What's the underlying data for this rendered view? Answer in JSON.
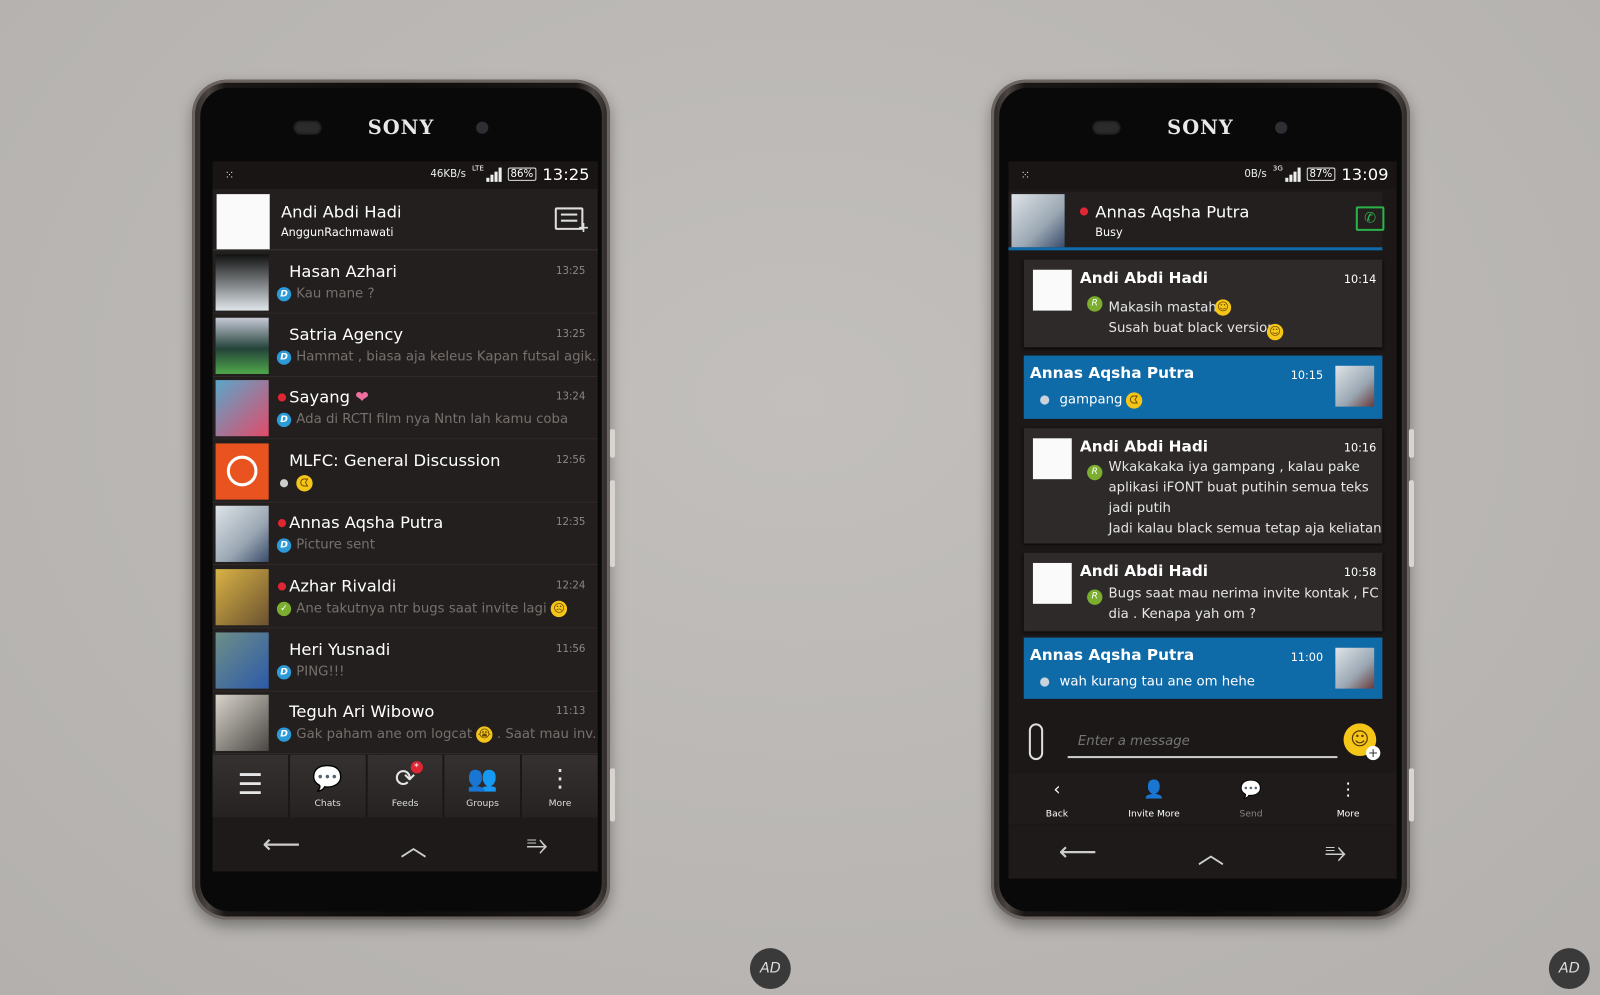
{
  "brand": "SONY",
  "colors": {
    "accent_blue": "#0f6aa8",
    "busy_red": "#e02633",
    "bbm_badge": "#2d9ad8",
    "read_green": "#7bad2e",
    "call_green": "#2bb34a"
  },
  "left": {
    "status": {
      "speed": "46KB/s",
      "network": "LTE",
      "battery": "86%",
      "time": "13:25"
    },
    "profile": {
      "name": "Andi Abdi Hadi",
      "status": "AnggunRachmawati",
      "new_chat_icon": "new-chat-icon"
    },
    "chats": [
      {
        "name": "Hasan Azhari",
        "time": "13:25",
        "message": "Kau mane ?",
        "badge": "D",
        "busy": false
      },
      {
        "name": "Satria Agency",
        "time": "13:25",
        "message": "Hammat , biasa aja keleus Kapan futsal agik...",
        "badge": "D",
        "busy": false
      },
      {
        "name": "Sayang",
        "time": "13:24",
        "message": "Ada di RCTI film nya Nntn lah kamu coba",
        "badge": "D",
        "busy": true,
        "emoji": "heart"
      },
      {
        "name": "MLFC: General Discussion",
        "time": "12:56",
        "message": "",
        "badge": "dot",
        "busy": false,
        "emoji": "pacman"
      },
      {
        "name": "Annas Aqsha Putra",
        "time": "12:35",
        "message": "Picture sent",
        "badge": "D",
        "busy": true
      },
      {
        "name": "Azhar Rivaldi",
        "time": "12:24",
        "message": "Ane takutnya ntr bugs saat invite lagi",
        "badge": "check",
        "busy": true,
        "emoji": "sad"
      },
      {
        "name": "Heri Yusnadi",
        "time": "11:56",
        "message": "PING!!!",
        "badge": "D",
        "busy": false
      },
      {
        "name": "Teguh Ari Wibowo",
        "time": "11:13",
        "message": "Gak paham ane om logcat",
        "message_tail": ". Saat mau inv...",
        "badge": "D",
        "busy": false,
        "emoji": "cry"
      }
    ],
    "tabs": [
      {
        "label": "",
        "icon": "menu-icon"
      },
      {
        "label": "Chats",
        "icon": "chats-icon"
      },
      {
        "label": "Feeds",
        "icon": "feeds-icon"
      },
      {
        "label": "Groups",
        "icon": "groups-icon"
      },
      {
        "label": "More",
        "icon": "more-icon"
      }
    ]
  },
  "right": {
    "status": {
      "speed": "0B/s",
      "network": "3G",
      "battery": "87%",
      "time": "13:09"
    },
    "contact": {
      "name": "Annas Aqsha Putra",
      "status": "Busy"
    },
    "messages": [
      {
        "from": "Andi Abdi Hadi",
        "time": "10:14",
        "lines": [
          "Makasih mastah",
          "Susah buat black version"
        ],
        "mine": false,
        "badge": "R"
      },
      {
        "from": "Annas Aqsha Putra",
        "time": "10:15",
        "lines": [
          "gampang"
        ],
        "mine": true
      },
      {
        "from": "Andi Abdi Hadi",
        "time": "10:16",
        "lines": [
          "Wkakakaka iya gampang , kalau pake aplikasi iFONT buat putihin semua teks jadi putih",
          "Jadi kalau black semua tetap aja keliatan"
        ],
        "mine": false,
        "badge": "R"
      },
      {
        "from": "Andi Abdi Hadi",
        "time": "10:58",
        "lines": [
          "Bugs saat mau nerima invite kontak , FC dia . Kenapa yah om ?"
        ],
        "mine": false,
        "badge": "R"
      },
      {
        "from": "Annas Aqsha Putra",
        "time": "11:00",
        "lines": [
          "wah kurang tau ane om hehe"
        ],
        "mine": true
      }
    ],
    "input": {
      "placeholder": "Enter a message",
      "value": ""
    },
    "actions": [
      {
        "label": "Back",
        "icon": "back-icon"
      },
      {
        "label": "Invite More",
        "icon": "invite-icon"
      },
      {
        "label": "Send",
        "icon": "send-icon"
      },
      {
        "label": "More",
        "icon": "more-icon"
      }
    ]
  },
  "watermark": "AD"
}
